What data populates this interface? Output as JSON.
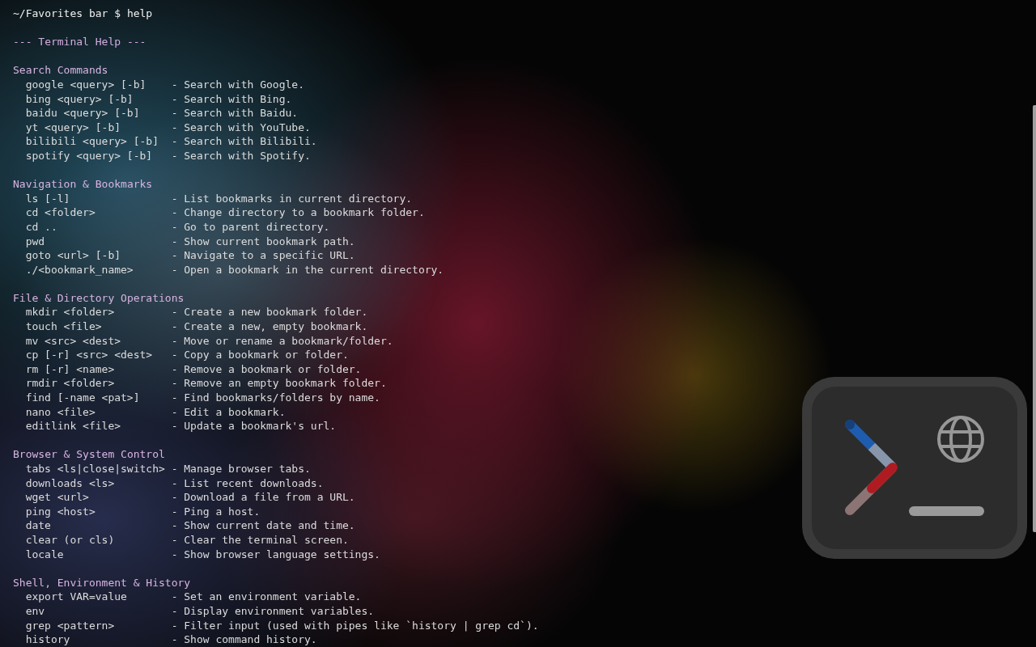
{
  "prompt": "~/Favorites bar $ help",
  "heading": "--- Terminal Help ---",
  "sections": [
    {
      "title": "Search Commands",
      "commands": [
        {
          "command": "google <query> [-b]",
          "description": "- Search with Google."
        },
        {
          "command": "bing <query> [-b]",
          "description": "- Search with Bing."
        },
        {
          "command": "baidu <query> [-b]",
          "description": "- Search with Baidu."
        },
        {
          "command": "yt <query> [-b]",
          "description": "- Search with YouTube."
        },
        {
          "command": "bilibili <query> [-b]",
          "description": "- Search with Bilibili."
        },
        {
          "command": "spotify <query> [-b]",
          "description": "- Search with Spotify."
        }
      ]
    },
    {
      "title": "Navigation & Bookmarks",
      "commands": [
        {
          "command": "ls [-l]",
          "description": "- List bookmarks in current directory."
        },
        {
          "command": "cd <folder>",
          "description": "- Change directory to a bookmark folder."
        },
        {
          "command": "cd ..",
          "description": "- Go to parent directory."
        },
        {
          "command": "pwd",
          "description": "- Show current bookmark path."
        },
        {
          "command": "goto <url> [-b]",
          "description": "- Navigate to a specific URL."
        },
        {
          "command": "./<bookmark_name>",
          "description": "- Open a bookmark in the current directory."
        }
      ]
    },
    {
      "title": "File & Directory Operations",
      "commands": [
        {
          "command": "mkdir <folder>",
          "description": "- Create a new bookmark folder."
        },
        {
          "command": "touch <file>",
          "description": "- Create a new, empty bookmark."
        },
        {
          "command": "mv <src> <dest>",
          "description": "- Move or rename a bookmark/folder."
        },
        {
          "command": "cp [-r] <src> <dest>",
          "description": "- Copy a bookmark or folder."
        },
        {
          "command": "rm [-r] <name>",
          "description": "- Remove a bookmark or folder."
        },
        {
          "command": "rmdir <folder>",
          "description": "- Remove an empty bookmark folder."
        },
        {
          "command": "find [-name <pat>]",
          "description": "- Find bookmarks/folders by name."
        },
        {
          "command": "nano <file>",
          "description": "- Edit a bookmark."
        },
        {
          "command": "editlink <file>",
          "description": "- Update a bookmark's url."
        }
      ]
    },
    {
      "title": "Browser & System Control",
      "commands": [
        {
          "command": "tabs <ls|close|switch>",
          "description": "- Manage browser tabs."
        },
        {
          "command": "downloads <ls>",
          "description": "- List recent downloads."
        },
        {
          "command": "wget <url>",
          "description": "- Download a file from a URL."
        },
        {
          "command": "ping <host>",
          "description": "- Ping a host."
        },
        {
          "command": "date",
          "description": "- Show current date and time."
        },
        {
          "command": "clear (or cls)",
          "description": "- Clear the terminal screen."
        },
        {
          "command": "locale",
          "description": "- Show browser language settings."
        }
      ]
    },
    {
      "title": "Shell, Environment & History",
      "commands": [
        {
          "command": "export VAR=value",
          "description": "- Set an environment variable."
        },
        {
          "command": "env",
          "description": "- Display environment variables."
        },
        {
          "command": "grep <pattern>",
          "description": "- Filter input (used with pipes like `history | grep cd`)."
        },
        {
          "command": "history",
          "description": "- Show command history."
        }
      ]
    }
  ]
}
